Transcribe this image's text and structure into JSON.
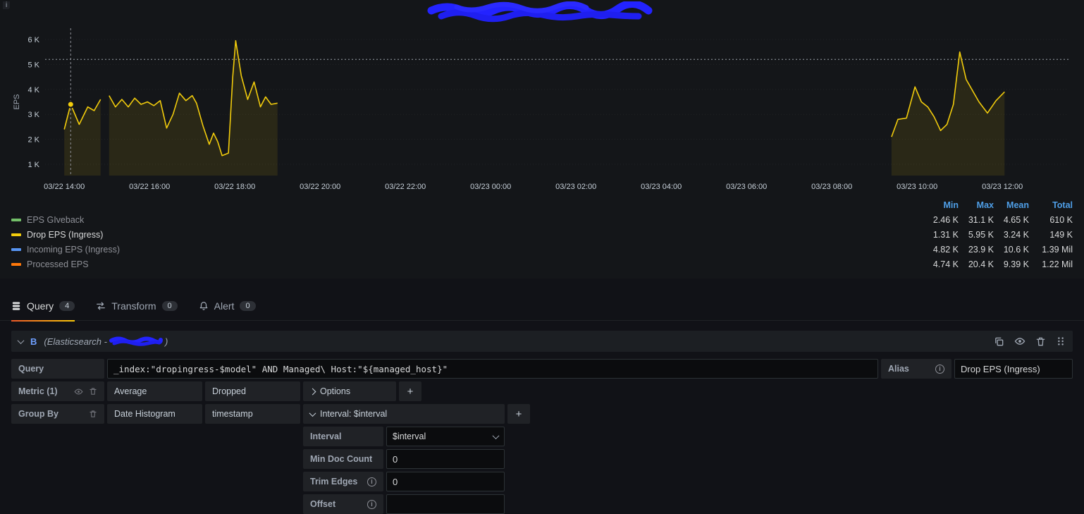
{
  "panel": {
    "info_glyph": "i",
    "yaxis_label": "EPS",
    "legend": {
      "headers": [
        "Min",
        "Max",
        "Mean",
        "Total"
      ],
      "series": [
        {
          "name": "EPS GIveback",
          "color": "#73bf69",
          "name_color": "#8e9097",
          "min": "2.46 K",
          "max": "31.1 K",
          "mean": "4.65 K",
          "total": "610 K"
        },
        {
          "name": "Drop EPS (Ingress)",
          "color": "#f2cc0c",
          "name_color": "#d8d9da",
          "min": "1.31 K",
          "max": "5.95 K",
          "mean": "3.24 K",
          "total": "149 K"
        },
        {
          "name": "Incoming EPS (Ingress)",
          "color": "#5794f2",
          "name_color": "#8e9097",
          "min": "4.82 K",
          "max": "23.9 K",
          "mean": "10.6 K",
          "total": "1.39 Mil"
        },
        {
          "name": "Processed EPS",
          "color": "#ff780a",
          "name_color": "#8e9097",
          "min": "4.74 K",
          "max": "20.4 K",
          "mean": "9.39 K",
          "total": "1.22 Mil"
        }
      ]
    }
  },
  "chart_data": {
    "type": "line",
    "title": "[redacted panel title]",
    "ylabel": "EPS",
    "xlim": [
      -0.45,
      23.55
    ],
    "ylim": [
      0.55,
      6.45
    ],
    "threshold": 5.2,
    "cursor": {
      "t": 0.15,
      "v": 3.4
    },
    "x_ticks": [
      {
        "t": 0,
        "label": "03/22 14:00"
      },
      {
        "t": 2,
        "label": "03/22 16:00"
      },
      {
        "t": 4,
        "label": "03/22 18:00"
      },
      {
        "t": 6,
        "label": "03/22 20:00"
      },
      {
        "t": 8,
        "label": "03/22 22:00"
      },
      {
        "t": 10,
        "label": "03/23 00:00"
      },
      {
        "t": 12,
        "label": "03/23 02:00"
      },
      {
        "t": 14,
        "label": "03/23 04:00"
      },
      {
        "t": 16,
        "label": "03/23 06:00"
      },
      {
        "t": 18,
        "label": "03/23 08:00"
      },
      {
        "t": 20,
        "label": "03/23 10:00"
      },
      {
        "t": 22,
        "label": "03/23 12:00"
      }
    ],
    "y_ticks": [
      {
        "v": 1,
        "label": "1 K"
      },
      {
        "v": 2,
        "label": "2 K"
      },
      {
        "v": 3,
        "label": "3 K"
      },
      {
        "v": 4,
        "label": "4 K"
      },
      {
        "v": 5,
        "label": "5 K"
      },
      {
        "v": 6,
        "label": "6 K"
      }
    ],
    "series": [
      {
        "name": "Drop EPS (Ingress)",
        "color": "#f2cc0c",
        "fill_opacity": 0.1,
        "segments": [
          [
            [
              0,
              2.4
            ],
            [
              0.15,
              3.4
            ],
            [
              0.35,
              2.6
            ],
            [
              0.55,
              3.3
            ],
            [
              0.7,
              3.15
            ],
            [
              0.85,
              3.6
            ]
          ],
          [
            [
              1.05,
              3.75
            ],
            [
              1.2,
              3.3
            ],
            [
              1.35,
              3.6
            ],
            [
              1.5,
              3.3
            ],
            [
              1.65,
              3.65
            ],
            [
              1.8,
              3.4
            ],
            [
              1.95,
              3.5
            ],
            [
              2.1,
              3.35
            ],
            [
              2.25,
              3.55
            ],
            [
              2.4,
              2.45
            ],
            [
              2.55,
              3.0
            ],
            [
              2.7,
              3.85
            ],
            [
              2.85,
              3.55
            ],
            [
              3.0,
              3.75
            ],
            [
              3.1,
              3.45
            ],
            [
              3.25,
              2.55
            ],
            [
              3.4,
              1.8
            ],
            [
              3.5,
              2.25
            ],
            [
              3.6,
              1.9
            ],
            [
              3.7,
              1.35
            ],
            [
              3.85,
              1.45
            ],
            [
              3.95,
              4.5
            ],
            [
              4.02,
              5.95
            ],
            [
              4.15,
              4.55
            ],
            [
              4.3,
              3.6
            ],
            [
              4.45,
              4.3
            ],
            [
              4.6,
              3.3
            ],
            [
              4.72,
              3.7
            ],
            [
              4.85,
              3.4
            ],
            [
              5.0,
              3.45
            ]
          ],
          [
            [
              19.4,
              2.1
            ],
            [
              19.55,
              2.8
            ],
            [
              19.75,
              2.85
            ],
            [
              19.95,
              4.1
            ],
            [
              20.1,
              3.5
            ],
            [
              20.25,
              3.3
            ],
            [
              20.4,
              2.9
            ],
            [
              20.55,
              2.35
            ],
            [
              20.7,
              2.6
            ],
            [
              20.85,
              3.4
            ],
            [
              21.0,
              5.5
            ],
            [
              21.15,
              4.4
            ],
            [
              21.3,
              3.95
            ],
            [
              21.45,
              3.5
            ],
            [
              21.65,
              3.05
            ],
            [
              21.85,
              3.55
            ],
            [
              22.05,
              3.9
            ]
          ]
        ]
      }
    ]
  },
  "tabs": [
    {
      "label": "Query",
      "count": "4",
      "active": true
    },
    {
      "label": "Transform",
      "count": "0",
      "active": false
    },
    {
      "label": "Alert",
      "count": "0",
      "active": false
    }
  ],
  "query_row": {
    "ref": "B",
    "datasource_prefix": "(Elasticsearch - ",
    "datasource_suffix": ")"
  },
  "editor": {
    "query_label": "Query",
    "query_value": "_index:\"dropingress-$model\" AND Managed\\ Host:\"${managed_host}\"",
    "alias_label": "Alias",
    "alias_value": "Drop EPS (Ingress)",
    "metric_label": "Metric (1)",
    "metric_agg": "Average",
    "metric_field": "Dropped",
    "options_label": "Options",
    "add_label": "+",
    "groupby_label": "Group By",
    "groupby_type": "Date Histogram",
    "groupby_field": "timestamp",
    "interval_header": "Interval: $interval",
    "settings": [
      {
        "label": "Interval",
        "value": "$interval",
        "info": false
      },
      {
        "label": "Min Doc Count",
        "value": "0",
        "info": false
      },
      {
        "label": "Trim Edges",
        "value": "0",
        "info": true
      },
      {
        "label": "Offset",
        "value": "",
        "info": true
      }
    ]
  },
  "icons": {
    "info_glyph": "i",
    "panel_info": "panel-info-corner",
    "query_tab": "database-icon",
    "transform_tab": "swap-arrows-icon",
    "alert_tab": "bell-icon",
    "duplicate": "copy-icon",
    "visibility": "eye-icon",
    "delete": "trash-icon",
    "drag": "grip-dots-icon"
  }
}
